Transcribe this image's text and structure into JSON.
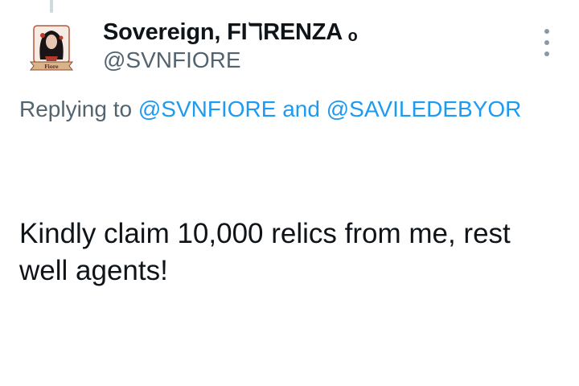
{
  "tweet": {
    "author": {
      "display_name": "Sovereign, FI",
      "display_name_glyph": "ℸ",
      "display_name_tail": "RENZA ₒ",
      "handle": "@SVNFIORE",
      "avatar_caption": "Fiore"
    },
    "reply_context": {
      "prefix": "Replying to ",
      "mention_1": "@SVNFIORE",
      "joiner": " and ",
      "mention_2": "@SAVILEDEBYOR"
    },
    "text_line_1": "Kindly claim 10,000 relics from me, rest",
    "text_line_2": "well agents!"
  },
  "icons": {
    "more": "more-vertical-icon"
  },
  "colors": {
    "text_primary": "#0f1419",
    "text_secondary": "#536471",
    "link": "#1d9bf0",
    "thread_line": "#cfd9de"
  }
}
